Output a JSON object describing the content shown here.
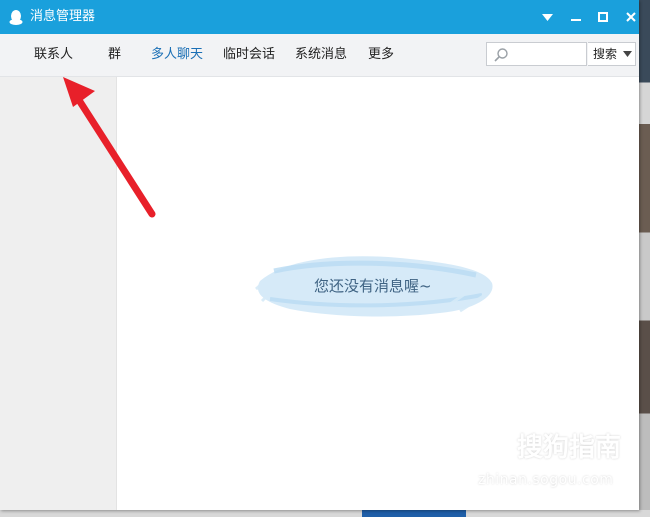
{
  "window": {
    "title": "消息管理器",
    "accent_color": "#1aa0dc"
  },
  "titlebar_buttons": {
    "menu_icon": "dropdown-triangle",
    "minimize_icon": "minimize",
    "maximize_icon": "maximize",
    "close_icon": "close"
  },
  "tabs": [
    {
      "label": "联系人",
      "active": false
    },
    {
      "label": "群",
      "active": false
    },
    {
      "label": "多人聊天",
      "active": true
    },
    {
      "label": "临时会话",
      "active": false
    },
    {
      "label": "系统消息",
      "active": false
    },
    {
      "label": "更多",
      "active": false
    }
  ],
  "search": {
    "value": "",
    "placeholder": "",
    "button_label": "搜索"
  },
  "content": {
    "empty_message": "您还没有消息喔~"
  },
  "annotation": {
    "arrow_color": "#e8202a"
  },
  "watermark": {
    "title": "搜狗指南",
    "url": "zhinan.sogou.com"
  }
}
